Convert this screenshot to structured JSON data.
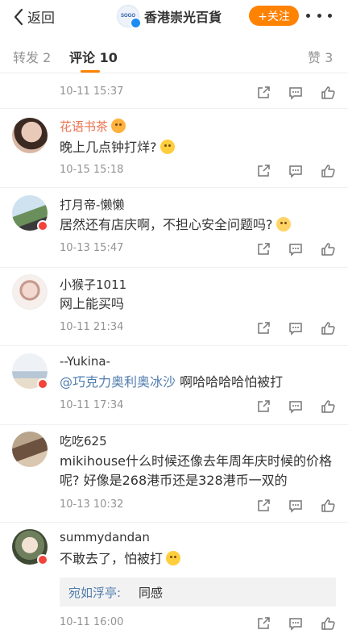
{
  "nav": {
    "back_label": "返回",
    "logo_text": "SOGO",
    "account_title": "香港崇光百貨",
    "follow_label": "+关注"
  },
  "tabs": [
    {
      "label": "转发 2"
    },
    {
      "label": "评论 10"
    },
    {
      "label": "赞 3"
    }
  ],
  "comments": [
    {
      "name": "",
      "text": "",
      "time": "10-11 15:37"
    },
    {
      "name": "花语书茶",
      "text": "晚上几点钟打烊?",
      "time": "10-15 15:18"
    },
    {
      "name": "打月帝-懒懒",
      "text": "居然还有店庆啊，不担心安全问题吗?",
      "time": "10-13 15:47"
    },
    {
      "name": "小猴子1011",
      "text": "网上能买吗",
      "time": "10-11 21:34"
    },
    {
      "name": "--Yukina-",
      "mention": "@巧克力奥利奥冰沙",
      "text": " 啊哈哈哈哈怕被打",
      "time": "10-11 17:34"
    },
    {
      "name": "吃吃625",
      "text": "mikihouse什么时候还像去年周年庆时候的价格呢? 好像是268港币还是328港币一双的",
      "time": "10-13 10:32"
    },
    {
      "name": "summydandan",
      "text": "不敢去了，怕被打",
      "time": "10-11 16:00",
      "reply": {
        "name": "宛如浮亭:",
        "text": "同感"
      }
    }
  ],
  "colors": {
    "accent": "#ff8200",
    "link": "#507daf",
    "muted": "#939393"
  }
}
